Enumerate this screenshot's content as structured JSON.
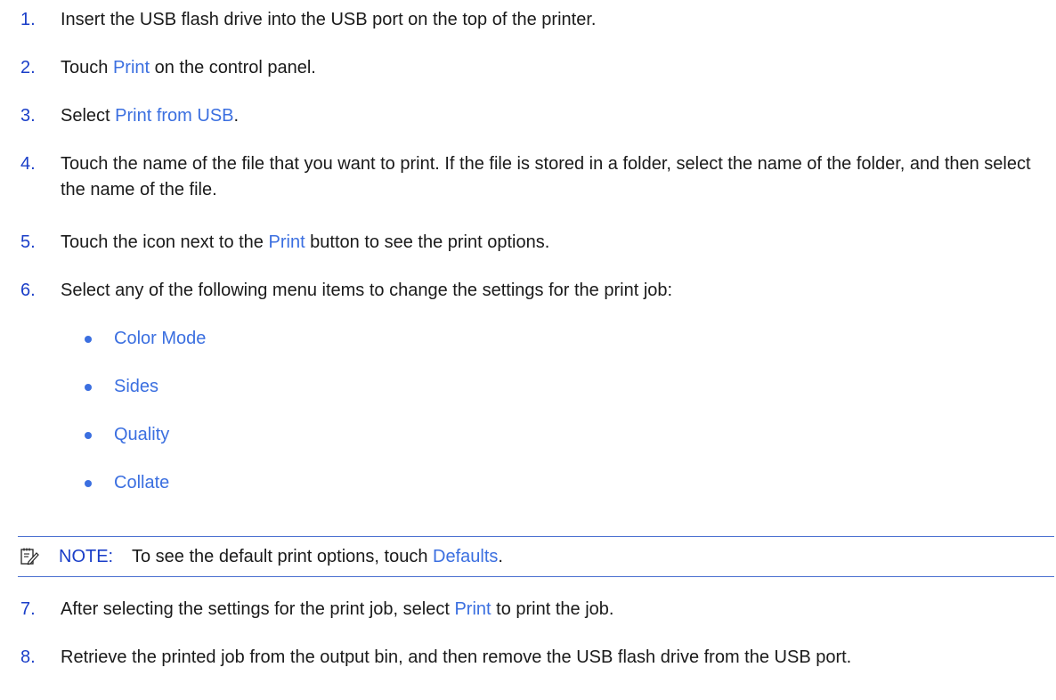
{
  "steps": [
    {
      "num": "1.",
      "parts": [
        {
          "text": "Insert the USB flash drive into the USB port on the top of the printer.",
          "link": false
        }
      ]
    },
    {
      "num": "2.",
      "parts": [
        {
          "text": "Touch ",
          "link": false
        },
        {
          "text": "Print",
          "link": true
        },
        {
          "text": " on the control panel.",
          "link": false
        }
      ]
    },
    {
      "num": "3.",
      "parts": [
        {
          "text": "Select ",
          "link": false
        },
        {
          "text": "Print from USB",
          "link": true
        },
        {
          "text": ".",
          "link": false
        }
      ]
    },
    {
      "num": "4.",
      "parts": [
        {
          "text": "Touch the name of the file that you want to print. If the file is stored in a folder, select the name of the folder, and then select the name of the file.",
          "link": false
        }
      ]
    },
    {
      "num": "5.",
      "parts": [
        {
          "text": "Touch the icon next to the ",
          "link": false
        },
        {
          "text": "Print",
          "link": true
        },
        {
          "text": " button to see the print options.",
          "link": false
        }
      ]
    },
    {
      "num": "6.",
      "parts": [
        {
          "text": "Select any of the following menu items to change the settings for the print job:",
          "link": false
        }
      ]
    },
    {
      "num": "7.",
      "parts": [
        {
          "text": "After selecting the settings for the print job, select ",
          "link": false
        },
        {
          "text": "Print",
          "link": true
        },
        {
          "text": " to print the job.",
          "link": false
        }
      ]
    },
    {
      "num": "8.",
      "parts": [
        {
          "text": "Retrieve the printed job from the output bin, and then remove the USB flash drive from the USB port.",
          "link": false
        }
      ]
    }
  ],
  "menu_items": [
    "Color Mode",
    "Sides",
    "Quality",
    "Collate"
  ],
  "note": {
    "label": "NOTE:",
    "text_before": "To see the default print options, touch ",
    "link": "Defaults",
    "text_after": ".",
    "icon": "note-pencil-icon"
  },
  "colors": {
    "number": "#1a3ec8",
    "link": "#3b6fe0",
    "rule": "#4a6fd0",
    "text": "#1a1a1a"
  }
}
